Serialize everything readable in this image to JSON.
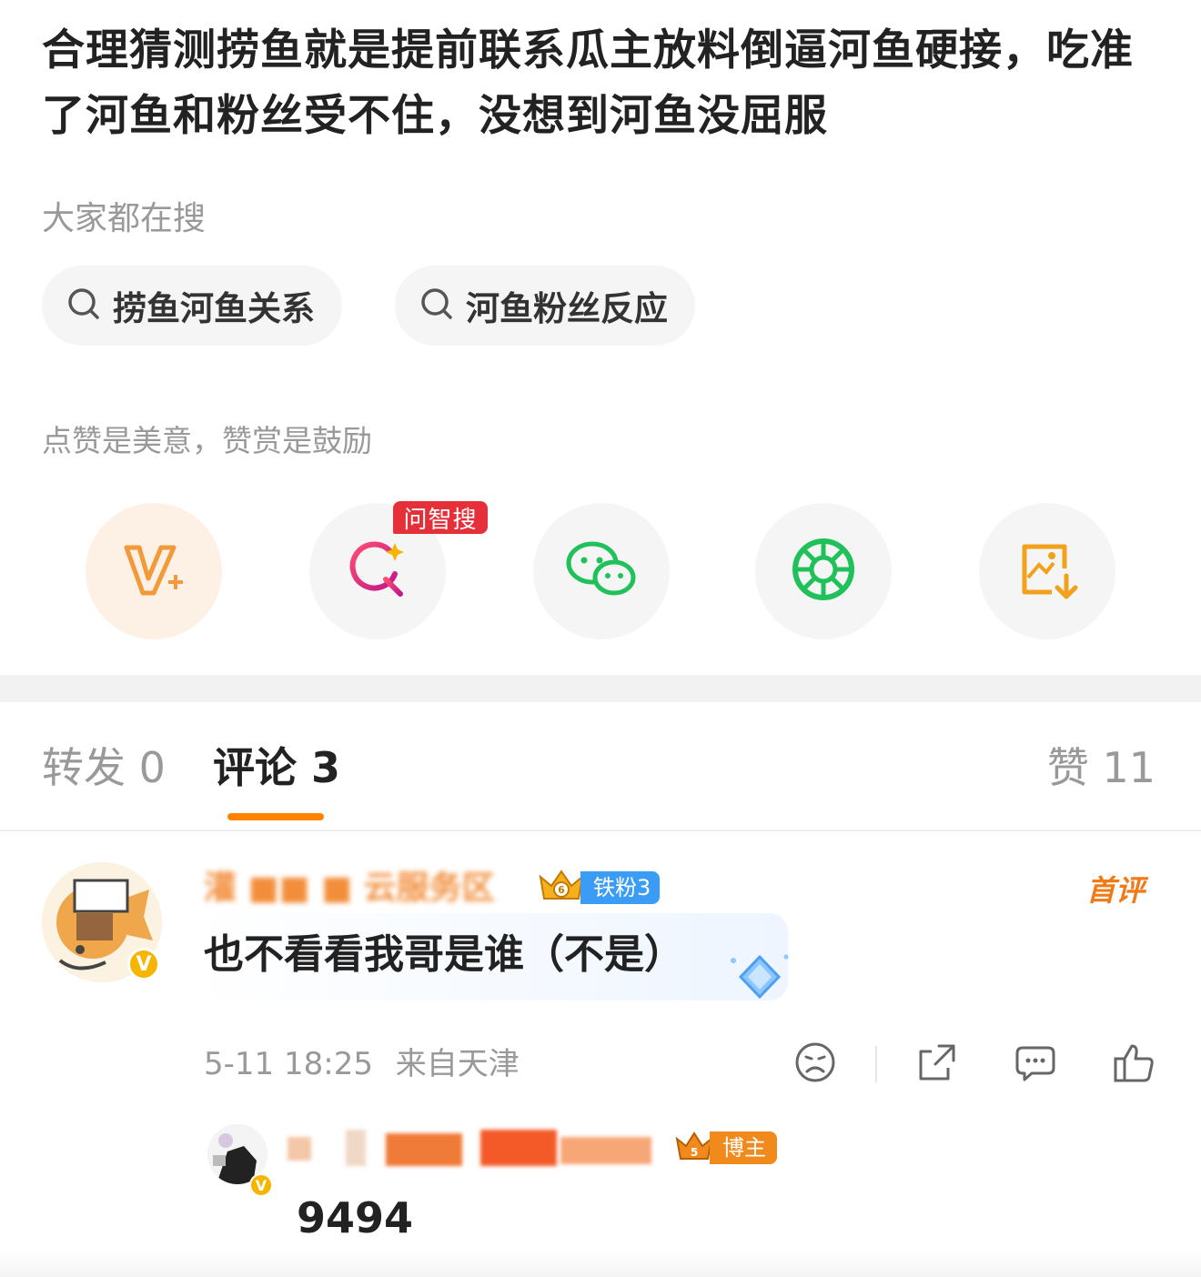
{
  "post": {
    "text": "合理猜测捞鱼就是提前联系瓜主放料倒逼河鱼硬接，吃准了河鱼和粉丝受不住，没想到河鱼没屈服"
  },
  "search": {
    "heading": "大家都在搜",
    "chips": [
      {
        "label": "捞鱼河鱼关系",
        "icon": "search-icon"
      },
      {
        "label": "河鱼粉丝反应",
        "icon": "search-icon"
      }
    ]
  },
  "reward": {
    "text": "点赞是美意，赞赏是鼓励"
  },
  "actions": {
    "items": [
      {
        "icon": "reward-v-icon"
      },
      {
        "icon": "ai-search-icon",
        "badge": "问智搜"
      },
      {
        "icon": "wechat-icon"
      },
      {
        "icon": "moments-icon"
      },
      {
        "icon": "save-image-icon"
      }
    ]
  },
  "tabs": {
    "repost": "转发 0",
    "comment": "评论 3",
    "like": "赞 11"
  },
  "comment": {
    "username": "灌 ■■ ■ 云服务区",
    "fan_badge": "铁粉3",
    "fan_level": "6",
    "first_tag": "首评",
    "text": "也不看看我哥是谁（不是）",
    "time": "5-11 18:25",
    "location": "来自天津",
    "verified": "V"
  },
  "reply": {
    "badge": "博主",
    "badge_level": "5",
    "text": "9494",
    "verified": "V"
  },
  "colors": {
    "accent": "#ff8200",
    "ask_badge": "#e5303a",
    "fan_badge": "#3b9cf5",
    "wechat_green": "#20c15a",
    "reward_orange": "#f29a3a"
  }
}
